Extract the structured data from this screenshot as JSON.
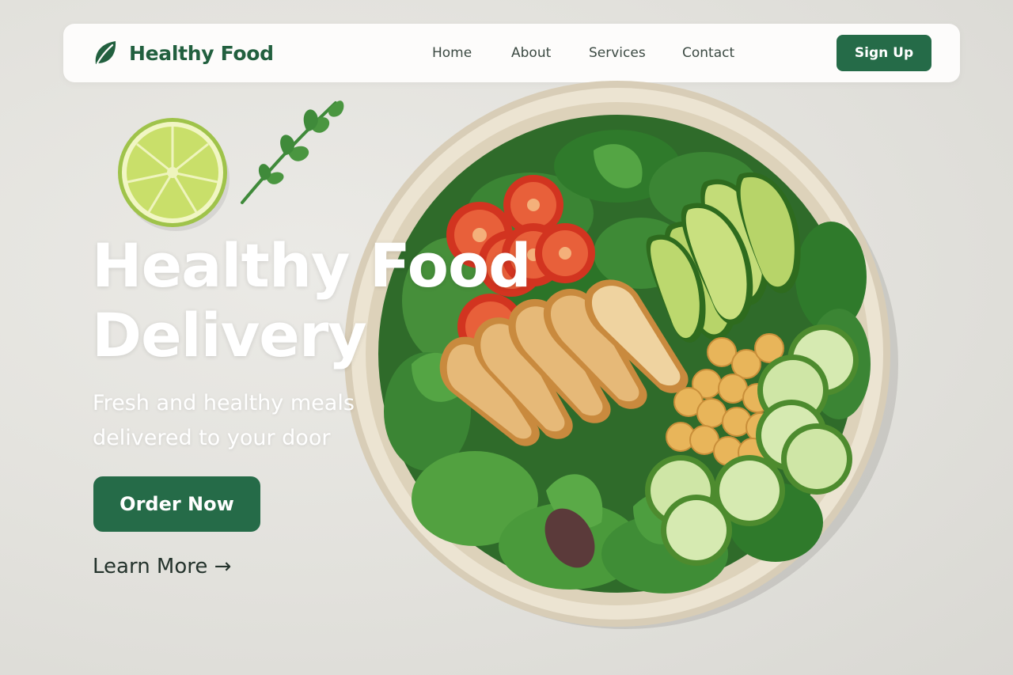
{
  "brand": {
    "name": "Healthy Food",
    "icon": "leaf-icon",
    "color": "#22603f"
  },
  "nav": {
    "links": [
      {
        "label": "Home"
      },
      {
        "label": "About"
      },
      {
        "label": "Services"
      },
      {
        "label": "Contact"
      }
    ],
    "signup_label": "Sign Up"
  },
  "hero": {
    "title_line1": "Healthy Food",
    "title_line2": "Delivery",
    "subtitle_line1": "Fresh and healthy meals",
    "subtitle_line2": "delivered to your door",
    "order_label": "Order Now",
    "learn_more_label": "Learn More →"
  },
  "colors": {
    "accent": "#256b48",
    "background": "#e4e3de",
    "navbar": "#fdfcfb",
    "hero_text": "#ffffff"
  },
  "images": {
    "bowl": "salad-bowl-photo",
    "lime": "lime-half",
    "herb": "arugula-leaf"
  }
}
